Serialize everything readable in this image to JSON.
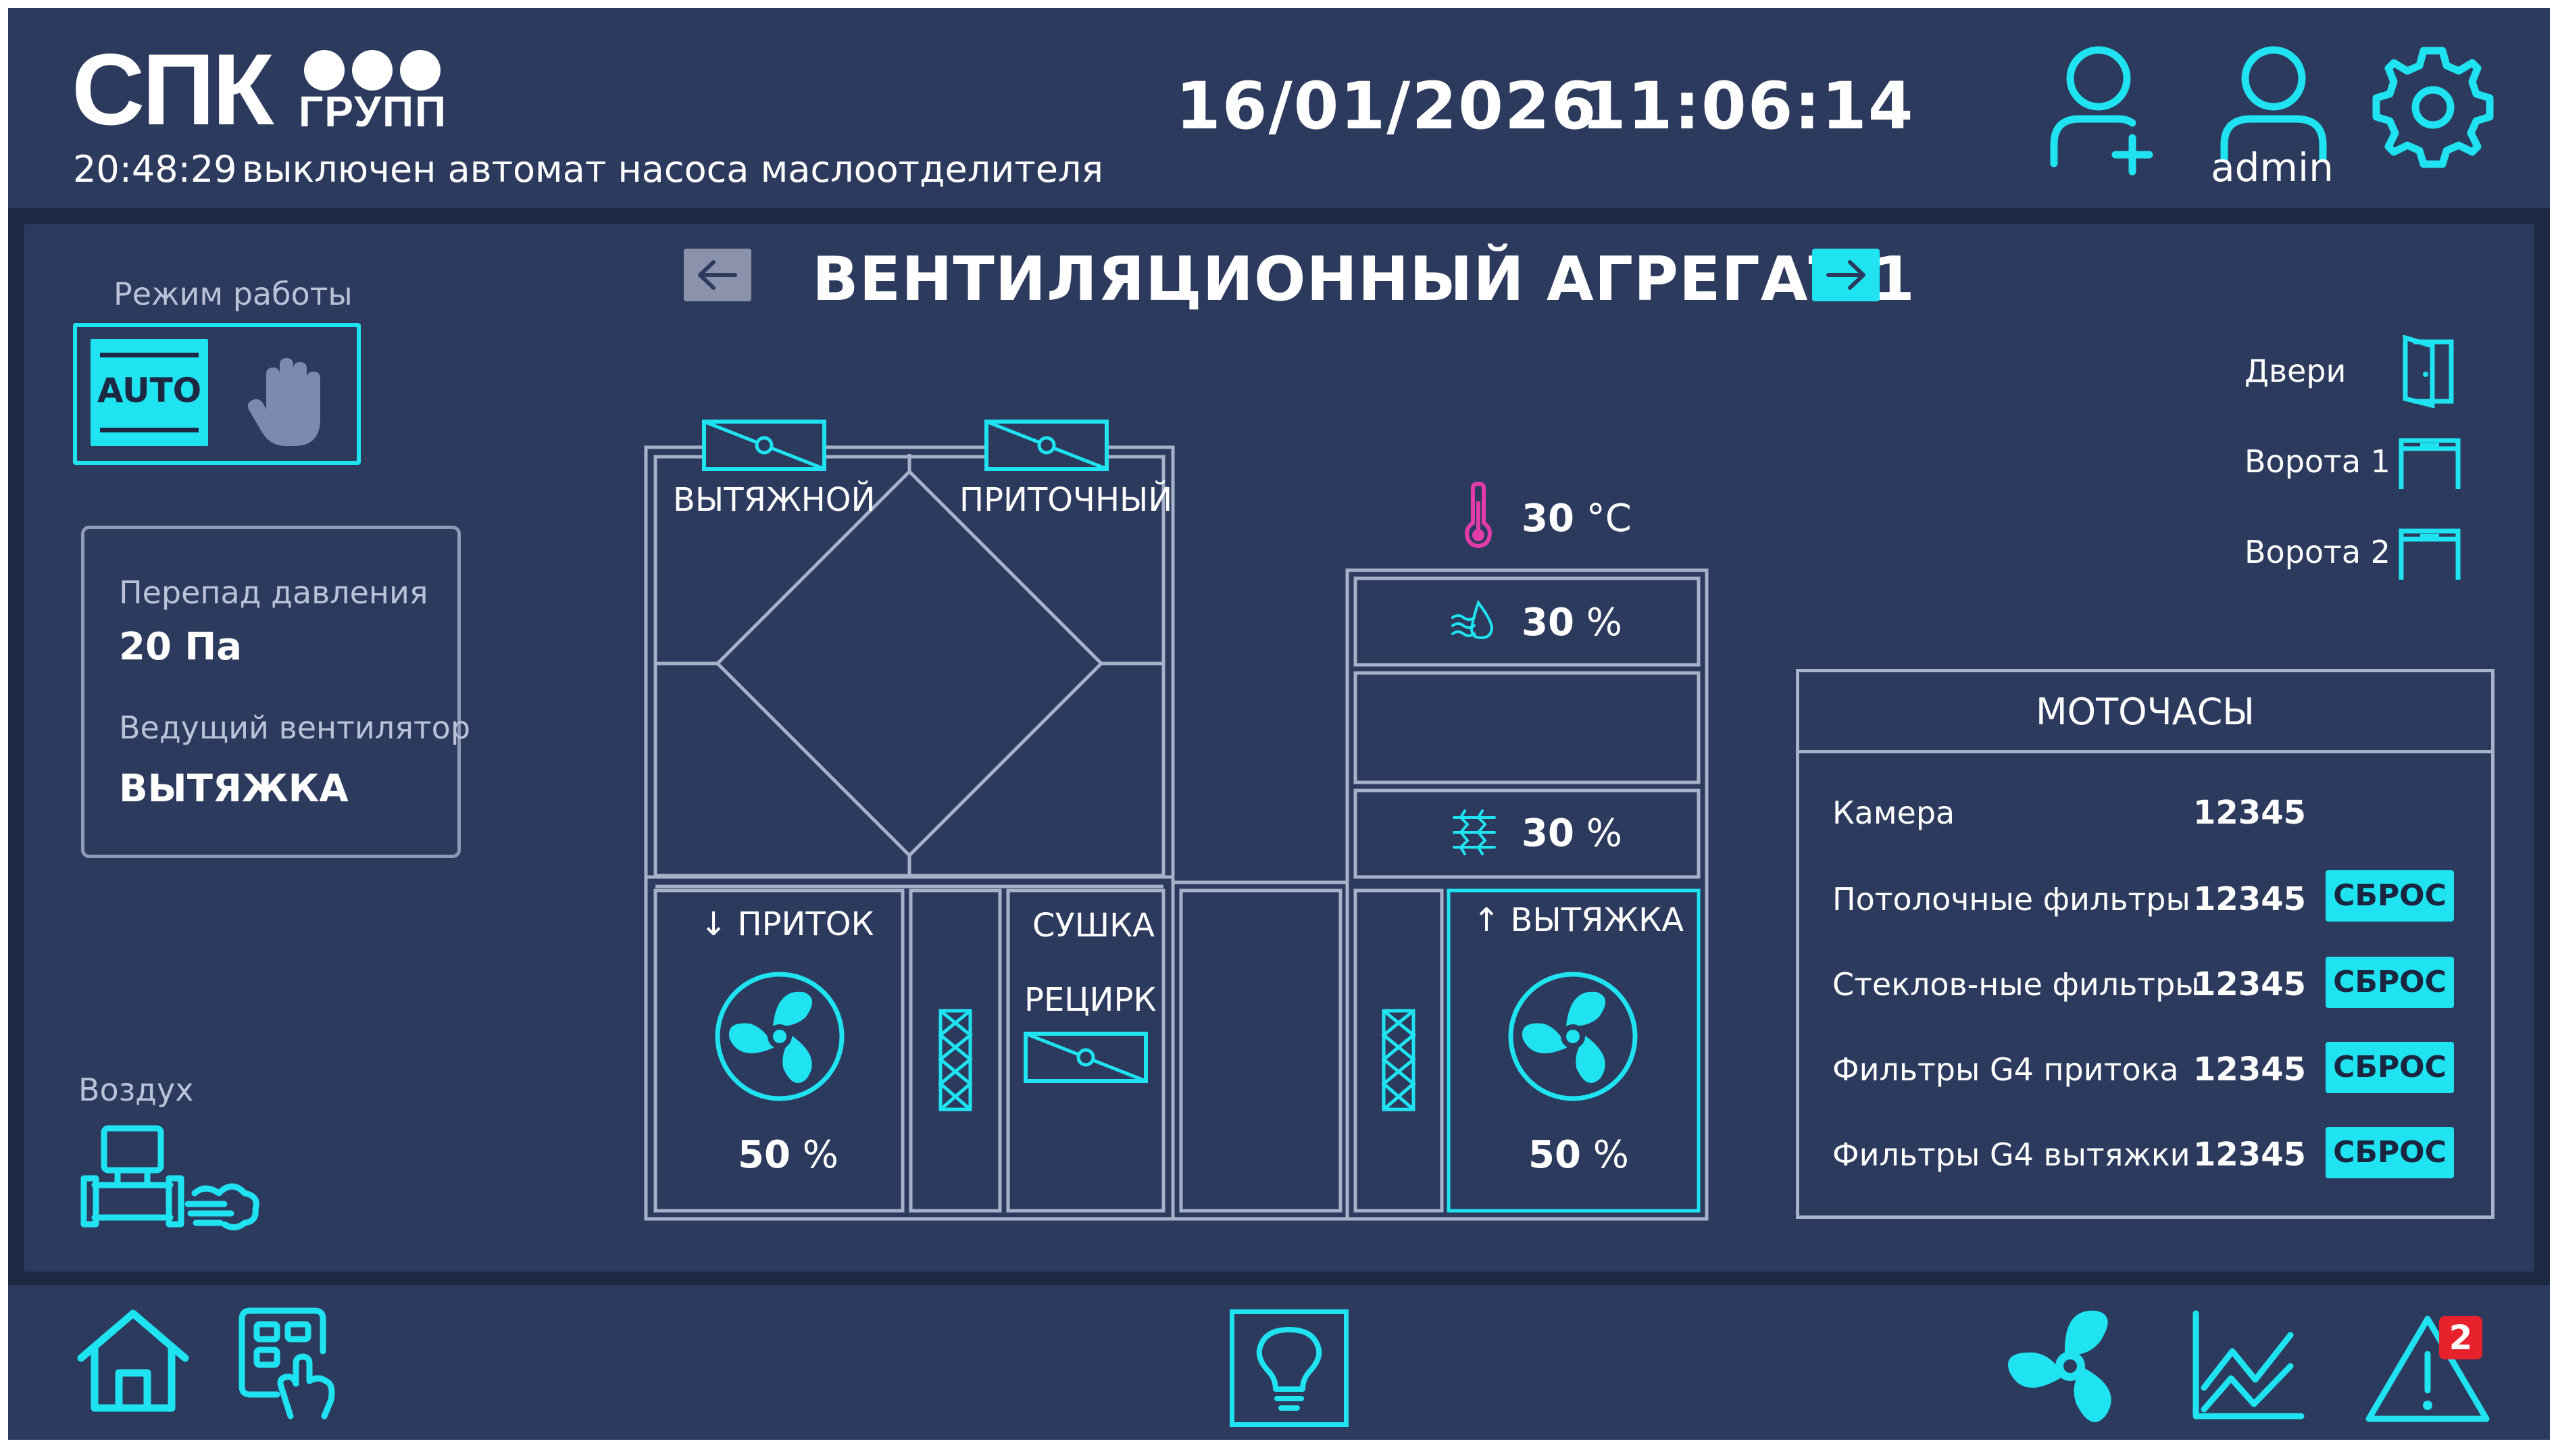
{
  "logo": {
    "main": "СПК",
    "sub": "ГРУПП"
  },
  "header": {
    "event_time": "20:48:29",
    "event_text": "выключен автомат насоса маслоотделителя",
    "date": "16/01/2026",
    "time": "11:06:14",
    "user": "admin"
  },
  "page": {
    "title": "ВЕНТИЛЯЦИОННЫЙ АГРЕГАТ 1"
  },
  "mode": {
    "label": "Режим работы",
    "auto": "AUTO"
  },
  "info": {
    "pressure_label": "Перепад давления",
    "pressure_value": "20 Па",
    "lead_fan_label": "Ведущий вентилятор",
    "lead_fan_value": "ВЫТЯЖКА"
  },
  "air": {
    "label": "Воздух"
  },
  "scheme": {
    "damper_exhaust": "ВЫТЯЖНОЙ",
    "damper_supply": "ПРИТОЧНЫЙ",
    "supply_label": "↓ ПРИТОК",
    "supply_value": "50",
    "dry_label": "СУШКА",
    "recirc_label": "РЕЦИРК",
    "exhaust_label": "↑ ВЫТЯЖКА",
    "exhaust_value": "50",
    "temperature": "30",
    "temp_unit": "°C",
    "humidity": "30",
    "heater": "30",
    "pct": "%"
  },
  "doors": [
    {
      "label": "Двери"
    },
    {
      "label": "Ворота 1"
    },
    {
      "label": "Ворота 2"
    }
  ],
  "motohours": {
    "title": "МОТОЧАСЫ",
    "reset_label": "СБРОС",
    "rows": [
      {
        "label": "Камера",
        "value": "12345"
      },
      {
        "label": "Потолочные фильтры",
        "value": "12345"
      },
      {
        "label": "Стеклов-ные фильтры",
        "value": "12345"
      },
      {
        "label": "Фильтры G4 притока",
        "value": "12345"
      },
      {
        "label": "Фильтры G4 вытяжки",
        "value": "12345"
      }
    ]
  },
  "alarms": {
    "count": "2"
  },
  "colors": {
    "accent": "#1fe3f0",
    "panel": "#2c3a5e",
    "background": "#1d2843",
    "line": "#a7b1c9",
    "alarm": "#e8222c",
    "thermo": "#e23ca8"
  }
}
